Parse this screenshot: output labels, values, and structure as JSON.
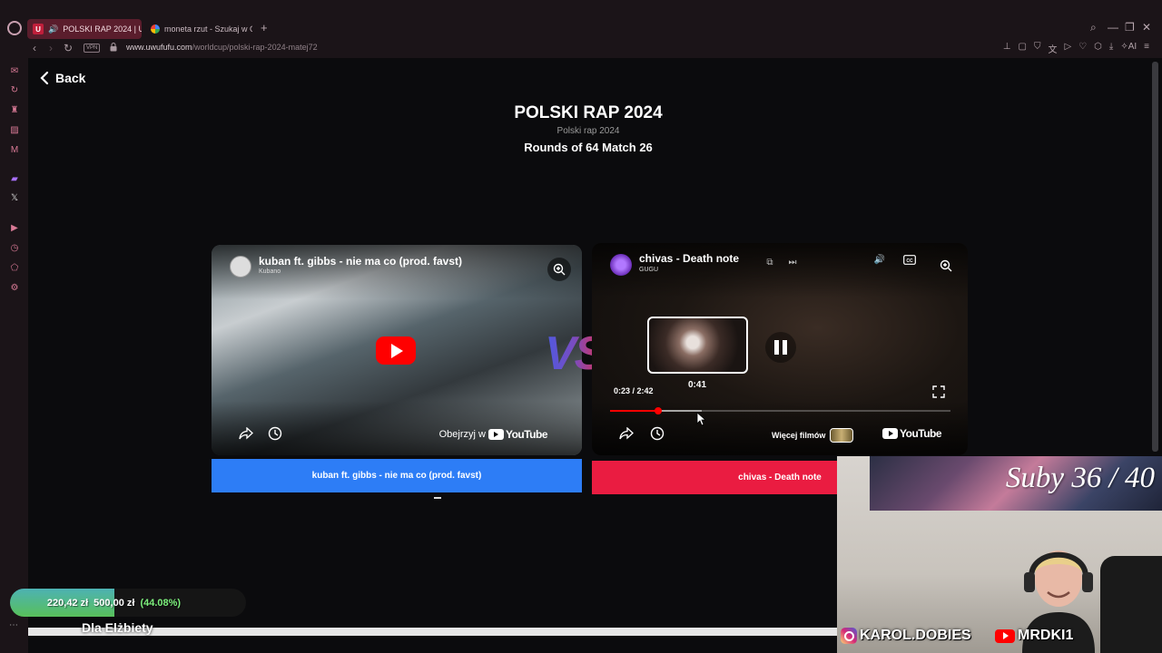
{
  "browser": {
    "tabs": [
      {
        "label": "POLSKI RAP 2024 | Uw",
        "badge": "U",
        "active": true
      },
      {
        "label": "moneta rzut - Szukaj w Go",
        "active": false
      }
    ],
    "new_tab": "+",
    "window_controls": {
      "search": "⌕",
      "minimize": "—",
      "restore": "❐",
      "close": "✕"
    },
    "vpn_label": "VPN",
    "url_domain": "www.uwufufu.com",
    "url_path": "/worldcup/polski-rap-2024-matej72",
    "ai_label": "AI"
  },
  "page": {
    "back_label": "Back",
    "title": "POLSKI RAP 2024",
    "subtitle": "Polski rap 2024",
    "round": "Rounds of 64 Match 26",
    "vs_label": "VS"
  },
  "left_video": {
    "title": "kuban ft. gibbs - nie ma co (prod. favst)",
    "channel": "Kubano",
    "watch_on": "Obejrzyj w",
    "youtube": "YouTube",
    "vote_label": "kuban ft. gibbs - nie ma co (prod. favst)"
  },
  "right_video": {
    "title": "chivas - Death note",
    "channel": "GUGU",
    "preview_time": "0:41",
    "current_time": "0:23 / 2:42",
    "progress_played": 0.14,
    "more_videos": "Więcej filmów",
    "youtube": "YouTube",
    "vote_label": "chivas - Death note"
  },
  "overlay": {
    "subs_text": "Suby 36 / 40",
    "instagram": "KAROL.DOBIES",
    "youtube_handle": "MRDKI1",
    "donation_current": "220,42 zł",
    "donation_goal": "500,00 zł",
    "donation_pct": "(44.08%)",
    "donation_fraction": 0.4408,
    "donation_label": "Dla Elżbiety"
  },
  "colors": {
    "vote_left": "#2d7df6",
    "vote_right": "#ea1c41",
    "accent": "#c01f3b"
  }
}
